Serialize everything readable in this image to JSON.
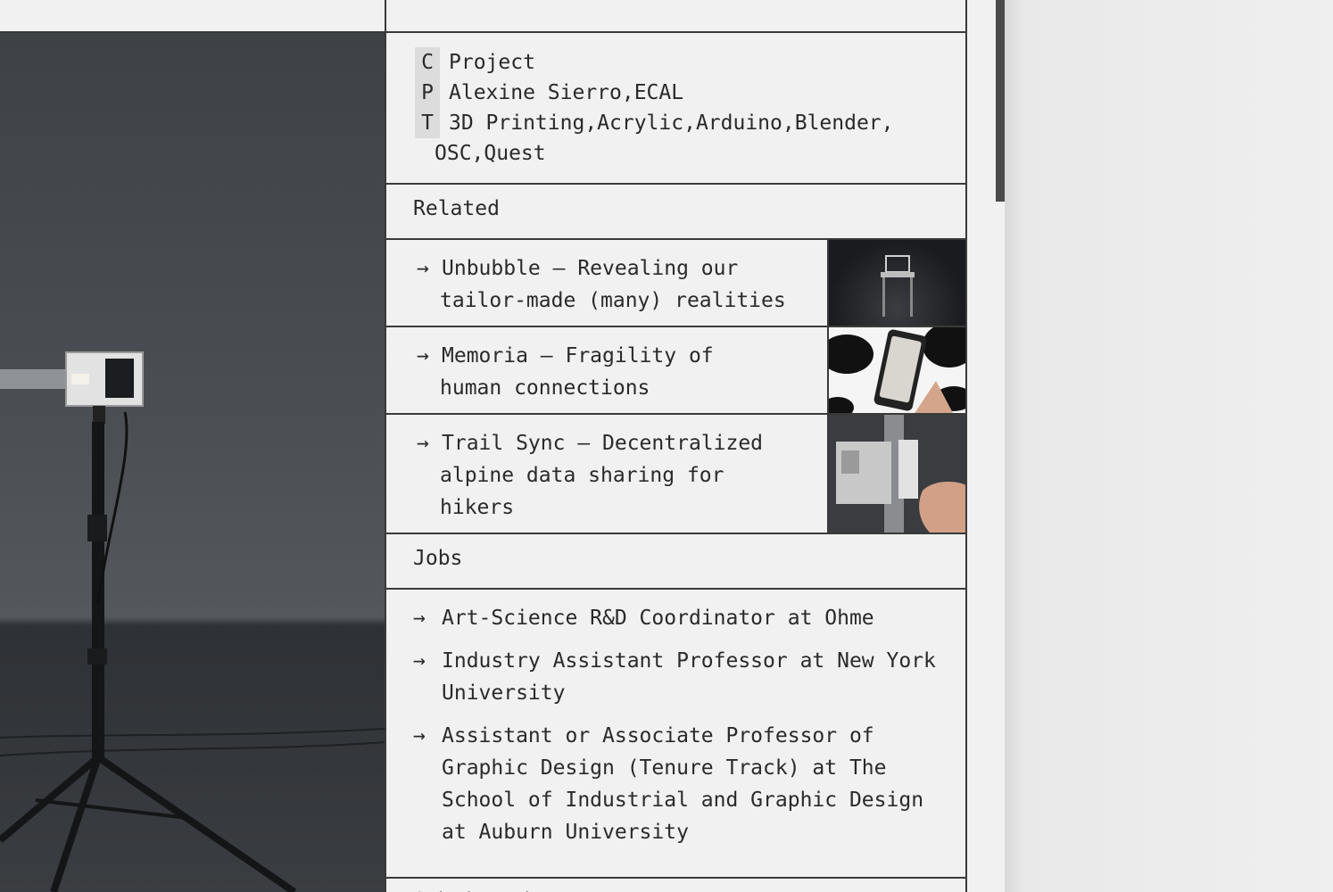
{
  "meta": {
    "rows": [
      {
        "key": "C",
        "value": "Project"
      },
      {
        "key": "P",
        "value": "Alexine Sierro,ECAL"
      },
      {
        "key": "T",
        "value": "3D Printing,Acrylic,Arduino,Blender,"
      }
    ],
    "tags_cont": "OSC,Quest"
  },
  "related": {
    "title": "Related",
    "items": [
      {
        "arrow": "→",
        "line1": "Unbubble – Revealing our",
        "line2": "tailor-made (many) realities",
        "line3": ""
      },
      {
        "arrow": "→",
        "line1": "Memoria – Fragility of",
        "line2": "human connections",
        "line3": ""
      },
      {
        "arrow": "→",
        "line1": "Trail Sync – Decentralized",
        "line2": "alpine data sharing for",
        "line3": "hikers"
      }
    ]
  },
  "jobs": {
    "title": "Jobs",
    "items": [
      {
        "arrow": "→",
        "text": "Art-Science R&D Coordinator at Ohme"
      },
      {
        "arrow": "→",
        "text": "Industry Assistant Professor at New York University"
      },
      {
        "arrow": "→",
        "text": "Assistant or Associate Professor of Graphic Design (Tenure Track) at The School of Industrial and Graphic Design at Auburn University"
      }
    ]
  },
  "submit": {
    "label": "Submit Job"
  }
}
